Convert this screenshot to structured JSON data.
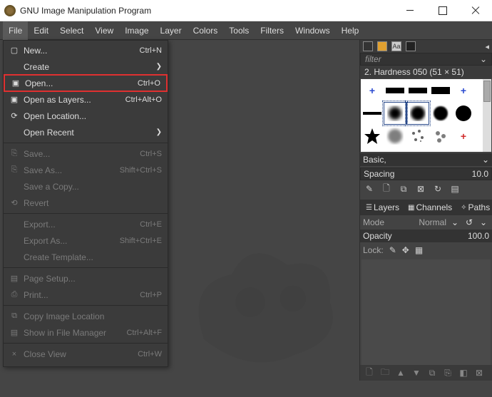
{
  "window": {
    "title": "GNU Image Manipulation Program"
  },
  "menubar": [
    "File",
    "Edit",
    "Select",
    "View",
    "Image",
    "Layer",
    "Colors",
    "Tools",
    "Filters",
    "Windows",
    "Help"
  ],
  "active_menu_index": 0,
  "file_menu": [
    {
      "type": "item",
      "icon": "▢",
      "label": "New...",
      "shortcut": "Ctrl+N"
    },
    {
      "type": "sub",
      "label": "Create"
    },
    {
      "type": "item",
      "icon": "▣",
      "label": "Open...",
      "shortcut": "Ctrl+O",
      "highlight": true
    },
    {
      "type": "item",
      "icon": "▣",
      "label": "Open as Layers...",
      "shortcut": "Ctrl+Alt+O"
    },
    {
      "type": "item",
      "icon": "⟳",
      "label": "Open Location..."
    },
    {
      "type": "sub",
      "label": "Open Recent"
    },
    {
      "type": "sep"
    },
    {
      "type": "item",
      "icon": "⎘",
      "label": "Save...",
      "shortcut": "Ctrl+S",
      "disabled": true
    },
    {
      "type": "item",
      "icon": "⎘",
      "label": "Save As...",
      "shortcut": "Shift+Ctrl+S",
      "disabled": true
    },
    {
      "type": "item",
      "label": "Save a Copy...",
      "disabled": true
    },
    {
      "type": "item",
      "icon": "⟲",
      "label": "Revert",
      "disabled": true
    },
    {
      "type": "sep"
    },
    {
      "type": "item",
      "label": "Export...",
      "shortcut": "Ctrl+E",
      "disabled": true
    },
    {
      "type": "item",
      "label": "Export As...",
      "shortcut": "Shift+Ctrl+E",
      "disabled": true
    },
    {
      "type": "item",
      "label": "Create Template...",
      "disabled": true
    },
    {
      "type": "sep"
    },
    {
      "type": "item",
      "icon": "▤",
      "label": "Page Setup...",
      "disabled": true
    },
    {
      "type": "item",
      "icon": "⎙",
      "label": "Print...",
      "shortcut": "Ctrl+P",
      "disabled": true
    },
    {
      "type": "sep"
    },
    {
      "type": "item",
      "icon": "⧉",
      "label": "Copy Image Location",
      "disabled": true
    },
    {
      "type": "item",
      "icon": "▤",
      "label": "Show in File Manager",
      "shortcut": "Ctrl+Alt+F",
      "disabled": true
    },
    {
      "type": "sep"
    },
    {
      "type": "item",
      "icon": "×",
      "label": "Close View",
      "shortcut": "Ctrl+W",
      "disabled": true
    }
  ],
  "brushes": {
    "filter_placeholder": "filter",
    "selected_label": "2. Hardness 050 (51 × 51)",
    "preset": "Basic,",
    "spacing_label": "Spacing",
    "spacing_value": "10.0"
  },
  "layers": {
    "tabs": [
      "Layers",
      "Channels",
      "Paths"
    ],
    "mode_label": "Mode",
    "mode_value": "Normal",
    "opacity_label": "Opacity",
    "opacity_value": "100.0",
    "lock_label": "Lock:"
  }
}
